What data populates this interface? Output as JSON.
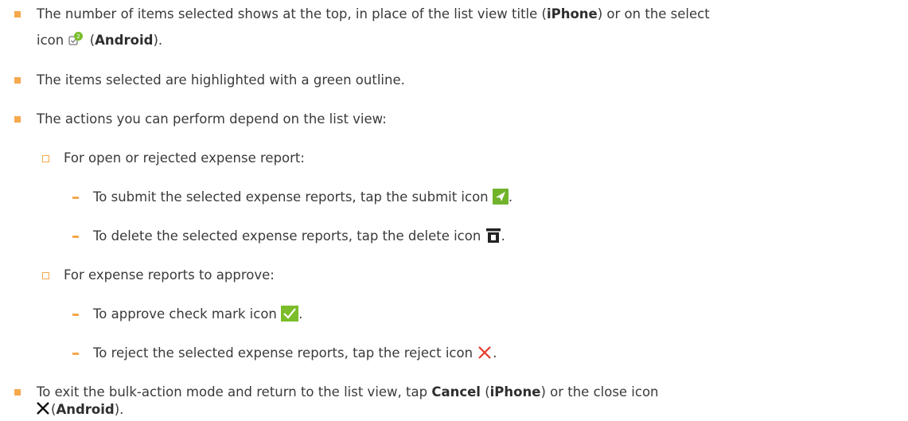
{
  "items": {
    "selected_count": {
      "part1": "The number of items selected shows at the top, in place of the list view title (",
      "iphone": "iPhone",
      "part2": ") or on the select",
      "line2_prefix": "icon ",
      "badge": "2",
      "line2_open": " (",
      "android": "Android",
      "line2_close": ")."
    },
    "highlight": "The items selected are highlighted with a green outline.",
    "actions_intro": "The actions you can perform depend on the list view:",
    "open_rejected": {
      "heading": "For open or rejected expense report:",
      "submit": "To submit the selected expense reports, tap the submit icon",
      "delete": "To delete the selected expense reports, tap the delete icon"
    },
    "approve_group": {
      "heading": "For expense reports to approve:",
      "approve": "To approve check mark icon",
      "reject": "To reject the selected expense reports, tap the reject icon"
    },
    "exit": {
      "part1": "To exit the bulk-action mode and return to the list view, tap ",
      "cancel": "Cancel",
      "part2": " (",
      "iphone": "iPhone",
      "part3": ") or the close icon",
      "line2_open": "(",
      "android": "Android",
      "line2_close": ")."
    },
    "period": "."
  },
  "colors": {
    "bullet": "#f5a84d",
    "submit_icon": "#71b32b",
    "approve_icon": "#7bbd2a",
    "reject_icon": "#e5392b",
    "badge": "#7bbd2a"
  }
}
